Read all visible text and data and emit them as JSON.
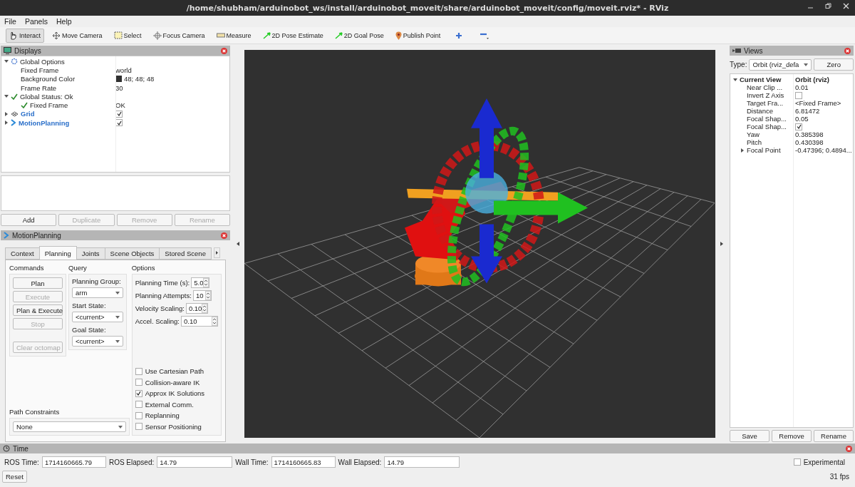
{
  "window": {
    "title": "/home/shubham/arduinobot_ws/install/arduinobot_moveit/share/arduinobot_moveit/config/moveit.rviz* - RViz"
  },
  "menu": [
    "File",
    "Panels",
    "Help"
  ],
  "toolbar": [
    {
      "label": "Interact",
      "kind": "hand",
      "selected": true
    },
    {
      "label": "Move Camera",
      "kind": "move",
      "selected": false
    },
    {
      "label": "Select",
      "kind": "select",
      "selected": false
    },
    {
      "label": "Focus Camera",
      "kind": "focus",
      "selected": false
    },
    {
      "label": "Measure",
      "kind": "ruler",
      "selected": false
    },
    {
      "label": "2D Pose Estimate",
      "kind": "pose",
      "selected": false
    },
    {
      "label": "2D Goal Pose",
      "kind": "pose",
      "selected": false
    },
    {
      "label": "Publish Point",
      "kind": "pin",
      "selected": false
    }
  ],
  "displays": {
    "title": "Displays",
    "tree": [
      {
        "label": "Global Options",
        "kind": "options",
        "expanded": true,
        "children": [
          {
            "label": "Fixed Frame",
            "value": "world",
            "kind": "property"
          },
          {
            "label": "Background Color",
            "value": "48; 48; 48",
            "kind": "color",
            "color": "#303030"
          },
          {
            "label": "Frame Rate",
            "value": "30",
            "kind": "property"
          }
        ]
      },
      {
        "label": "Global Status: Ok",
        "kind": "status",
        "expanded": true,
        "children": [
          {
            "label": "Fixed Frame",
            "value": "OK",
            "kind": "status"
          }
        ]
      },
      {
        "label": "Grid",
        "kind": "grid",
        "expanded": false,
        "checked": true
      },
      {
        "label": "MotionPlanning",
        "kind": "plugin",
        "expanded": false,
        "checked": true
      }
    ],
    "buttons": [
      {
        "label": "Add",
        "disabled": false
      },
      {
        "label": "Duplicate",
        "disabled": true
      },
      {
        "label": "Remove",
        "disabled": true
      },
      {
        "label": "Rename",
        "disabled": true
      }
    ]
  },
  "motion_planning": {
    "title": "MotionPlanning",
    "tabs": [
      {
        "label": "Context",
        "selected": false
      },
      {
        "label": "Planning",
        "selected": true
      },
      {
        "label": "Joints",
        "selected": false
      },
      {
        "label": "Scene Objects",
        "selected": false
      },
      {
        "label": "Stored Scene",
        "selected": false
      }
    ],
    "commands": {
      "title": "Commands",
      "buttons": [
        {
          "label": "Plan",
          "disabled": false
        },
        {
          "label": "Execute",
          "disabled": true
        },
        {
          "label": "Plan & Execute",
          "disabled": false
        },
        {
          "label": "Stop",
          "disabled": true
        },
        {
          "label": "Clear octomap",
          "disabled": true
        }
      ]
    },
    "query": {
      "title": "Query",
      "fields": [
        {
          "label": "Planning Group:",
          "value": "arm"
        },
        {
          "label": "Start State:",
          "value": "<current>"
        },
        {
          "label": "Goal State:",
          "value": "<current>"
        }
      ]
    },
    "options": {
      "title": "Options",
      "spinboxes": [
        {
          "label": "Planning Time (s):",
          "value": "5.0"
        },
        {
          "label": "Planning Attempts:",
          "value": "10"
        },
        {
          "label": "Velocity Scaling:",
          "value": "0.10"
        },
        {
          "label": "Accel. Scaling:",
          "value": "0.10"
        }
      ],
      "checkboxes": [
        {
          "label": "Use Cartesian Path",
          "checked": false
        },
        {
          "label": "Collision-aware IK",
          "checked": false
        },
        {
          "label": "Approx IK Solutions",
          "checked": true
        },
        {
          "label": "External Comm.",
          "checked": false
        },
        {
          "label": "Replanning",
          "checked": false
        },
        {
          "label": "Sensor Positioning",
          "checked": false
        }
      ]
    },
    "path_constraints": {
      "label": "Path Constraints",
      "value": "None"
    }
  },
  "views": {
    "title": "Views",
    "type_label": "Type:",
    "type_value": "Orbit (rviz_defa",
    "zero_button": "Zero",
    "tree": {
      "label": "Current View",
      "value": "Orbit (rviz)",
      "expanded": true,
      "children": [
        {
          "label": "Near Clip ...",
          "kind": "text",
          "value": "0.01"
        },
        {
          "label": "Invert Z Axis",
          "kind": "checkbox",
          "checked": false
        },
        {
          "label": "Target Fra...",
          "kind": "text",
          "value": "<Fixed Frame>"
        },
        {
          "label": "Distance",
          "kind": "text",
          "value": "6.81472"
        },
        {
          "label": "Focal Shap...",
          "kind": "text",
          "value": "0.05"
        },
        {
          "label": "Focal Shap...",
          "kind": "checkbox",
          "checked": true
        },
        {
          "label": "Yaw",
          "kind": "text",
          "value": "0.385398"
        },
        {
          "label": "Pitch",
          "kind": "text",
          "value": "0.430398"
        },
        {
          "label": "Focal Point",
          "kind": "text",
          "value": "-0.47396; 0.4894...",
          "expanded": false
        }
      ]
    },
    "buttons": [
      "Save",
      "Remove",
      "Rename"
    ]
  },
  "time": {
    "title": "Time",
    "fields": [
      {
        "label": "ROS Time:",
        "value": "1714160665.79"
      },
      {
        "label": "ROS Elapsed:",
        "value": "14.79"
      },
      {
        "label": "Wall Time:",
        "value": "1714160665.83"
      },
      {
        "label": "Wall Elapsed:",
        "value": "14.79"
      }
    ],
    "experimental": {
      "label": "Experimental",
      "checked": false
    },
    "reset_button": "Reset",
    "fps": "31 fps"
  }
}
